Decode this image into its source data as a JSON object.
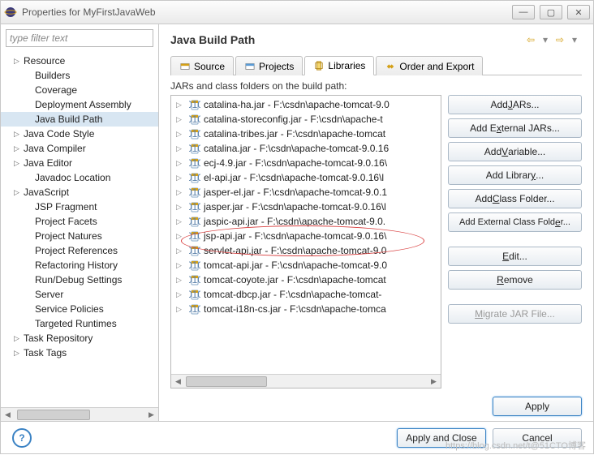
{
  "window": {
    "title": "Properties for MyFirstJavaWeb"
  },
  "filter_placeholder": "type filter text",
  "sidebar": {
    "items": [
      {
        "label": "Resource",
        "expandable": true
      },
      {
        "label": "Builders"
      },
      {
        "label": "Coverage"
      },
      {
        "label": "Deployment Assembly"
      },
      {
        "label": "Java Build Path",
        "selected": true
      },
      {
        "label": "Java Code Style",
        "expandable": true
      },
      {
        "label": "Java Compiler",
        "expandable": true
      },
      {
        "label": "Java Editor",
        "expandable": true
      },
      {
        "label": "Javadoc Location"
      },
      {
        "label": "JavaScript",
        "expandable": true
      },
      {
        "label": "JSP Fragment"
      },
      {
        "label": "Project Facets"
      },
      {
        "label": "Project Natures"
      },
      {
        "label": "Project References"
      },
      {
        "label": "Refactoring History"
      },
      {
        "label": "Run/Debug Settings"
      },
      {
        "label": "Server"
      },
      {
        "label": "Service Policies"
      },
      {
        "label": "Targeted Runtimes"
      },
      {
        "label": "Task Repository",
        "expandable": true
      },
      {
        "label": "Task Tags",
        "expandable": true
      }
    ]
  },
  "main": {
    "heading": "Java Build Path",
    "tabs": [
      {
        "label": "Source"
      },
      {
        "label": "Projects"
      },
      {
        "label": "Libraries",
        "active": true
      },
      {
        "label": "Order and Export"
      }
    ],
    "list_heading": "JARs and class folders on the build path:",
    "jars": [
      "catalina-ha.jar - F:\\csdn\\apache-tomcat-9.0",
      "catalina-storeconfig.jar - F:\\csdn\\apache-t",
      "catalina-tribes.jar - F:\\csdn\\apache-tomcat",
      "catalina.jar - F:\\csdn\\apache-tomcat-9.0.16",
      "ecj-4.9.jar - F:\\csdn\\apache-tomcat-9.0.16\\",
      "el-api.jar - F:\\csdn\\apache-tomcat-9.0.16\\l",
      "jasper-el.jar - F:\\csdn\\apache-tomcat-9.0.1",
      "jasper.jar - F:\\csdn\\apache-tomcat-9.0.16\\l",
      "jaspic-api.jar - F:\\csdn\\apache-tomcat-9.0.",
      "jsp-api.jar - F:\\csdn\\apache-tomcat-9.0.16\\",
      "servlet-api.jar - F:\\csdn\\apache-tomcat-9.0",
      "tomcat-api.jar - F:\\csdn\\apache-tomcat-9.0",
      "tomcat-coyote.jar - F:\\csdn\\apache-tomcat",
      "tomcat-dbcp.jar - F:\\csdn\\apache-tomcat-",
      "tomcat-i18n-cs.jar - F:\\csdn\\apache-tomca"
    ],
    "buttons": {
      "add_jars": "Add JARs...",
      "add_ext_jars": "Add External JARs...",
      "add_variable": "Add Variable...",
      "add_library": "Add Library...",
      "add_class_folder": "Add Class Folder...",
      "add_ext_class_folder": "Add External Class Folder...",
      "edit": "Edit...",
      "remove": "Remove",
      "migrate": "Migrate JAR File..."
    },
    "apply": "Apply"
  },
  "footer": {
    "apply_close": "Apply and Close",
    "cancel": "Cancel"
  },
  "watermark": "https://blog.csdn.net/t@51CTO博客"
}
